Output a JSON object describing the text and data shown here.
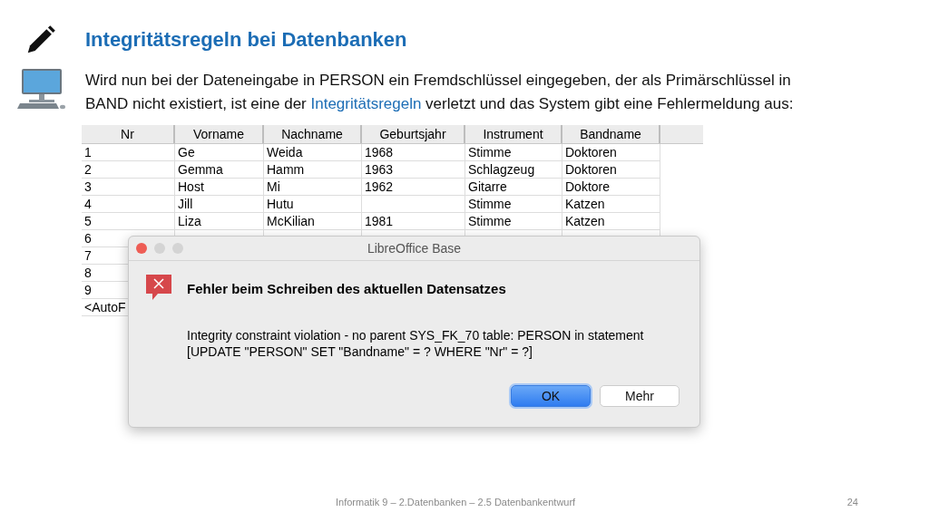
{
  "slide": {
    "title": "Integritätsregeln bei Datenbanken",
    "paragraph": [
      {
        "text": "Wird nun bei der Dateneingabe in PERSON ein Fremdschlüssel eingegeben, der als Primärschlüssel in BAND nicht existiert, ist eine der ",
        "highlight": false
      },
      {
        "text": "Integritätsregeln",
        "highlight": true
      },
      {
        "text": " verletzt und das System gibt eine Fehlermeldung aus:",
        "highlight": false
      }
    ]
  },
  "table": {
    "columns": [
      "Nr",
      "Vorname",
      "Nachname",
      "Geburtsjahr",
      "Instrument",
      "Bandname"
    ],
    "rows": [
      [
        "1",
        "Ge",
        "Weida",
        "1968",
        "Stimme",
        "Doktoren"
      ],
      [
        "2",
        "Gemma",
        "Hamm",
        "1963",
        "Schlagzeug",
        "Doktoren"
      ],
      [
        "3",
        "Host",
        "Mi",
        "1962",
        "Gitarre",
        "Doktore"
      ],
      [
        "4",
        "Jill",
        "Hutu",
        null,
        "Stimme",
        "Katzen"
      ],
      [
        "5",
        "Liza",
        "McKilian",
        "1981",
        "Stimme",
        "Katzen"
      ],
      [
        "6"
      ],
      [
        "7"
      ],
      [
        "8"
      ],
      [
        "9"
      ],
      [
        "<AutoF"
      ]
    ]
  },
  "dialog": {
    "title": "LibreOffice Base",
    "heading": "Fehler beim Schreiben des aktuellen Datensatzes",
    "message_lines": [
      "Integrity constraint violation - no parent SYS_FK_70 table: PERSON in statement",
      "[UPDATE \"PERSON\" SET \"Bandname\" = ? WHERE \"Nr\" = ?]"
    ],
    "buttons": [
      {
        "label": "OK",
        "default": true
      },
      {
        "label": "Mehr",
        "default": false
      }
    ]
  },
  "footer": {
    "text": "Informatik 9 – 2.Datenbanken – 2.5 Datenbankentwurf",
    "page": "24"
  }
}
